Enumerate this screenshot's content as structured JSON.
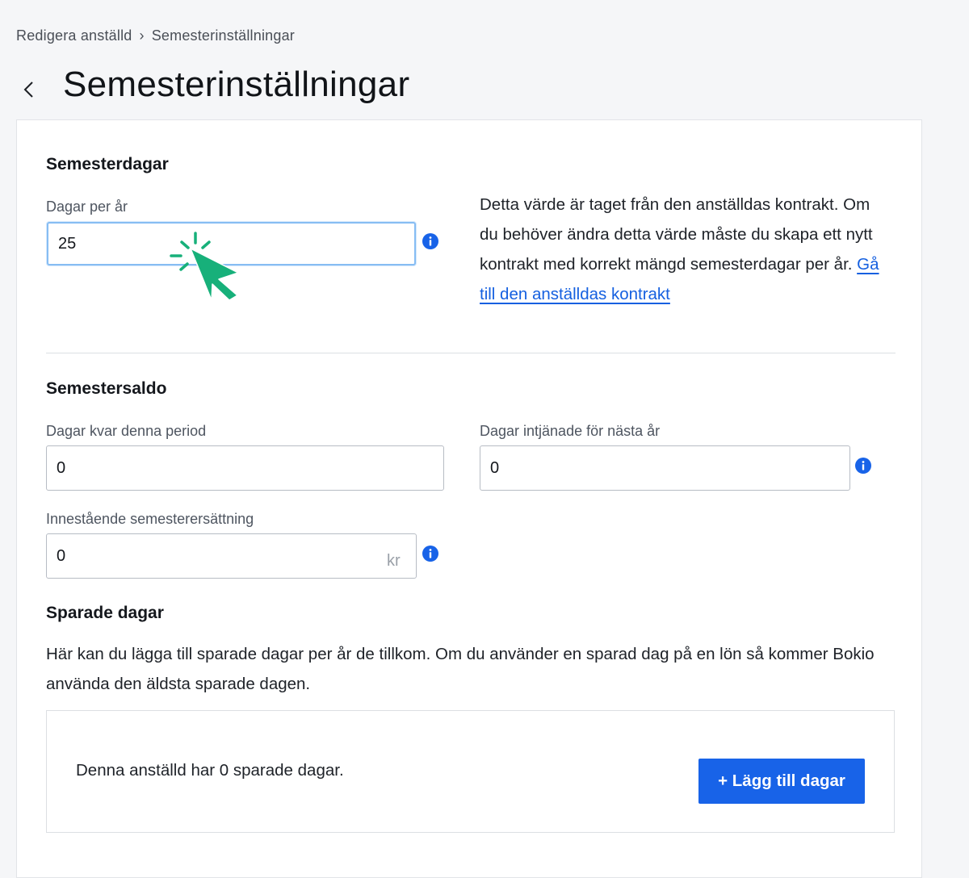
{
  "breadcrumb": {
    "parent": "Redigera anställd",
    "separator": "›",
    "current": "Semesterinställningar"
  },
  "page": {
    "title": "Semesterinställningar"
  },
  "vacation_days": {
    "heading": "Semesterdagar",
    "days_per_year_label": "Dagar per år",
    "days_per_year_value": "25",
    "description": "Detta värde är taget från den anställdas kontrakt. Om du behöver ändra detta värde måste du skapa ett nytt kontrakt med korrekt mängd semesterdagar per år.",
    "contract_link": "Gå till den anställdas kontrakt"
  },
  "balance": {
    "heading": "Semestersaldo",
    "remaining_label": "Dagar kvar denna period",
    "remaining_value": "0",
    "earned_label": "Dagar intjänade för nästa år",
    "earned_value": "0",
    "pay_label": "Innestående semesterersättning",
    "pay_value": "0",
    "pay_suffix": "kr"
  },
  "saved_days": {
    "heading": "Sparade dagar",
    "description": "Här kan du lägga till sparade dagar per år de tillkom. Om du använder en sparad dag på en lön så kommer Bokio använda den äldsta sparade dagen.",
    "empty_text": "Denna anställd har 0 sparade dagar.",
    "add_button": "+ Lägg till dagar"
  },
  "colors": {
    "accent": "#1863e8",
    "link": "#1560e0",
    "cursor": "#17b07a",
    "focus_border": "#87bdf3"
  },
  "icons": {
    "back": "chevron-left-icon",
    "info": "info-icon",
    "cursor": "click-cursor-icon"
  }
}
